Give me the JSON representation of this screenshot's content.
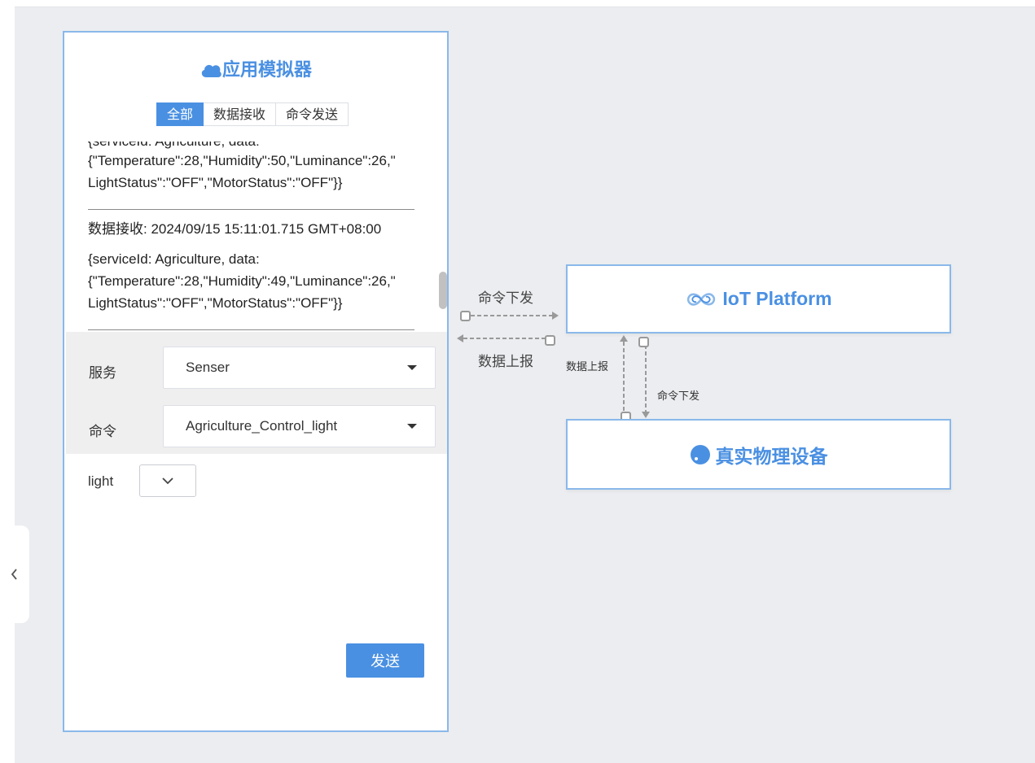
{
  "colors": {
    "accent": "#4a90e2",
    "panel_border": "#8ab8ea",
    "background": "#ebedf0"
  },
  "simulator": {
    "title": "应用模拟器",
    "title_icon": "cloud-icon",
    "tabs": [
      {
        "label": "全部",
        "active": true
      },
      {
        "label": "数据接收",
        "active": false
      },
      {
        "label": "命令发送",
        "active": false
      }
    ],
    "log": [
      {
        "partial_top": "{serviceId: Agriculture, data:",
        "body": "{\"Temperature\":28,\"Humidity\":50,\"Luminance\":26,\"",
        "body2": "LightStatus\":\"OFF\",\"MotorStatus\":\"OFF\"}}"
      },
      {
        "header": "数据接收: 2024/09/15 15:11:01.715 GMT+08:00",
        "line1": "{serviceId: Agriculture, data:",
        "line2": "{\"Temperature\":28,\"Humidity\":49,\"Luminance\":26,\"",
        "line3": "LightStatus\":\"OFF\",\"MotorStatus\":\"OFF\"}}"
      }
    ],
    "form": {
      "service_label": "服务",
      "service_value": "Senser",
      "command_label": "命令",
      "command_value": "Agriculture_Control_light",
      "light_label": "light",
      "light_value": ""
    },
    "send_label": "发送"
  },
  "diagram": {
    "platform_label": "IoT Platform",
    "platform_icon": "infinity-icon",
    "device_label": "真实物理设备",
    "device_icon": "device-dot-icon",
    "edge_cmd_down_h": "命令下发",
    "edge_data_up_h": "数据上报",
    "edge_data_up_v": "数据上报",
    "edge_cmd_down_v": "命令下发"
  },
  "sidebar": {
    "collapse_icon": "chevron-left-icon"
  }
}
